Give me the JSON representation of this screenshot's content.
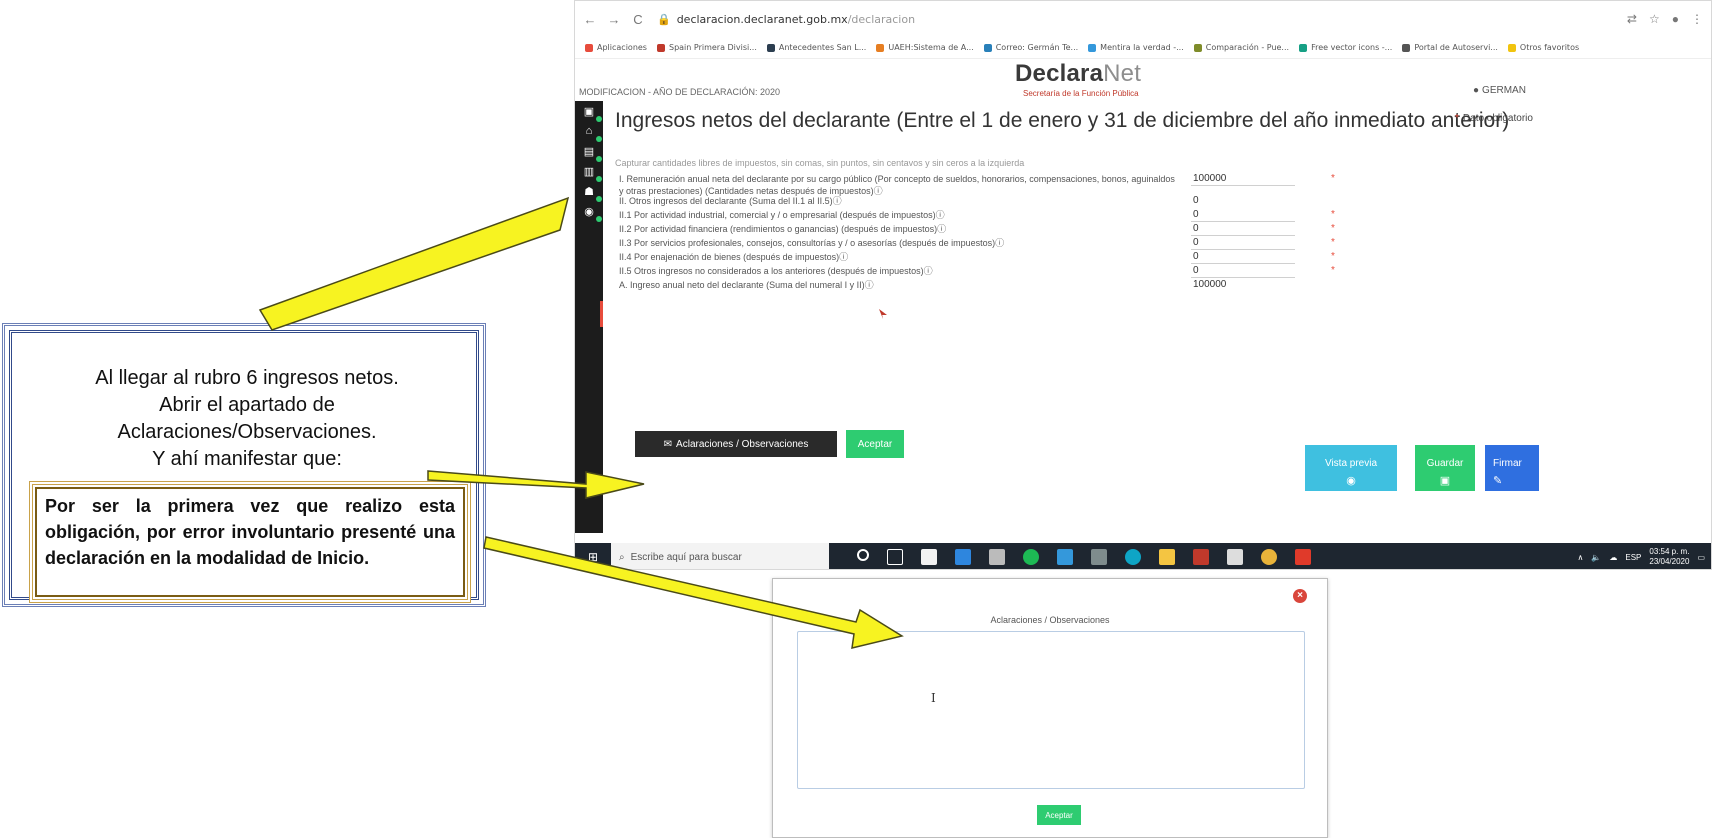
{
  "browser": {
    "url_host": "declaracion.declaranet.gob.mx",
    "url_path": "/declaracion",
    "bookmarks": [
      {
        "label": "Aplicaciones",
        "color": "#e74c3c"
      },
      {
        "label": "Spain Primera Divisi...",
        "color": "#c0392b"
      },
      {
        "label": "Antecedentes San L...",
        "color": "#2c3e50"
      },
      {
        "label": "UAEH:Sistema de A...",
        "color": "#e67e22"
      },
      {
        "label": "Correo: Germán Te...",
        "color": "#2980b9"
      },
      {
        "label": "Mentira la verdad -...",
        "color": "#3498db"
      },
      {
        "label": "Comparación - Pue...",
        "color": "#7f8c2a"
      },
      {
        "label": "Free vector icons -...",
        "color": "#16a085"
      },
      {
        "label": "Portal de Autoservi...",
        "color": "#555555"
      },
      {
        "label": "Otros favoritos",
        "color": "#f1c40f"
      }
    ]
  },
  "app": {
    "mode": "MODIFICACION - AÑO DE DECLARACIÓN: 2020",
    "logo_bold": "Declara",
    "logo_light": "Net",
    "subtitle": "Secretaría de la Función Pública",
    "user": "GERMAN",
    "title": "Ingresos netos del declarante (Entre el 1 de enero y 31 de diciembre del año inmediato anterior)",
    "required_note": "Dato obligatorio",
    "hint": "Capturar cantidades libres de impuestos, sin comas, sin puntos, sin centavos y sin ceros a la izquierda",
    "fields": [
      {
        "label": "I. Remuneración anual neta del declarante por su cargo público (Por concepto de sueldos, honorarios, compensaciones, bonos, aguinaldos y otras prestaciones) (Cantidades netas después de impuestos)ⓘ",
        "value": "100000",
        "required": true,
        "plain": false
      },
      {
        "label": "II. Otros ingresos del declarante (Suma del II.1 al II.5)ⓘ",
        "value": "0",
        "required": false,
        "plain": true
      },
      {
        "label": "II.1 Por actividad industrial, comercial y / o empresarial (después de impuestos)ⓘ",
        "value": "0",
        "required": true,
        "plain": false
      },
      {
        "label": "II.2 Por actividad financiera (rendimientos o ganancias) (después de impuestos)ⓘ",
        "value": "0",
        "required": true,
        "plain": false
      },
      {
        "label": "II.3 Por servicios profesionales, consejos, consultorías y / o asesorías (después de impuestos)ⓘ",
        "value": "0",
        "required": true,
        "plain": false
      },
      {
        "label": "II.4 Por enajenación de bienes (después de impuestos)ⓘ",
        "value": "0",
        "required": true,
        "plain": false
      },
      {
        "label": "II.5 Otros ingresos no considerados a los anteriores (después de impuestos)ⓘ",
        "value": "0",
        "required": true,
        "plain": false
      },
      {
        "label": "A. Ingreso anual neto del declarante (Suma del numeral I y II)ⓘ",
        "value": "100000",
        "required": false,
        "plain": true
      }
    ],
    "aclaraciones_button": "Aclaraciones / Observaciones",
    "aceptar_button": "Aceptar",
    "vista_previa_button": "Vista previa",
    "guardar_button": "Guardar",
    "firmar_button": "Firmar"
  },
  "taskbar": {
    "search_placeholder": "Escribe aquí para buscar",
    "lang": "ESP",
    "time": "03:54 p. m.",
    "date": "23/04/2020"
  },
  "instructions": {
    "lines": [
      "Al llegar al rubro 6 ingresos netos.",
      "Abrir el apartado de",
      "Aclaraciones/Observaciones.",
      "Y ahí manifestar que:"
    ],
    "quote": "Por ser la primera vez que realizo esta obligación, por error involuntario presenté una declaración en la modalidad de Inicio."
  },
  "modal": {
    "title": "Aclaraciones / Observaciones",
    "aceptar": "Aceptar",
    "textarea_value": ""
  },
  "colors": {
    "arrow_fill": "#f7f321",
    "arrow_stroke": "#4a4a18",
    "green": "#2ecc71",
    "blue": "#2f6fe0",
    "teal": "#3fc0e0"
  }
}
